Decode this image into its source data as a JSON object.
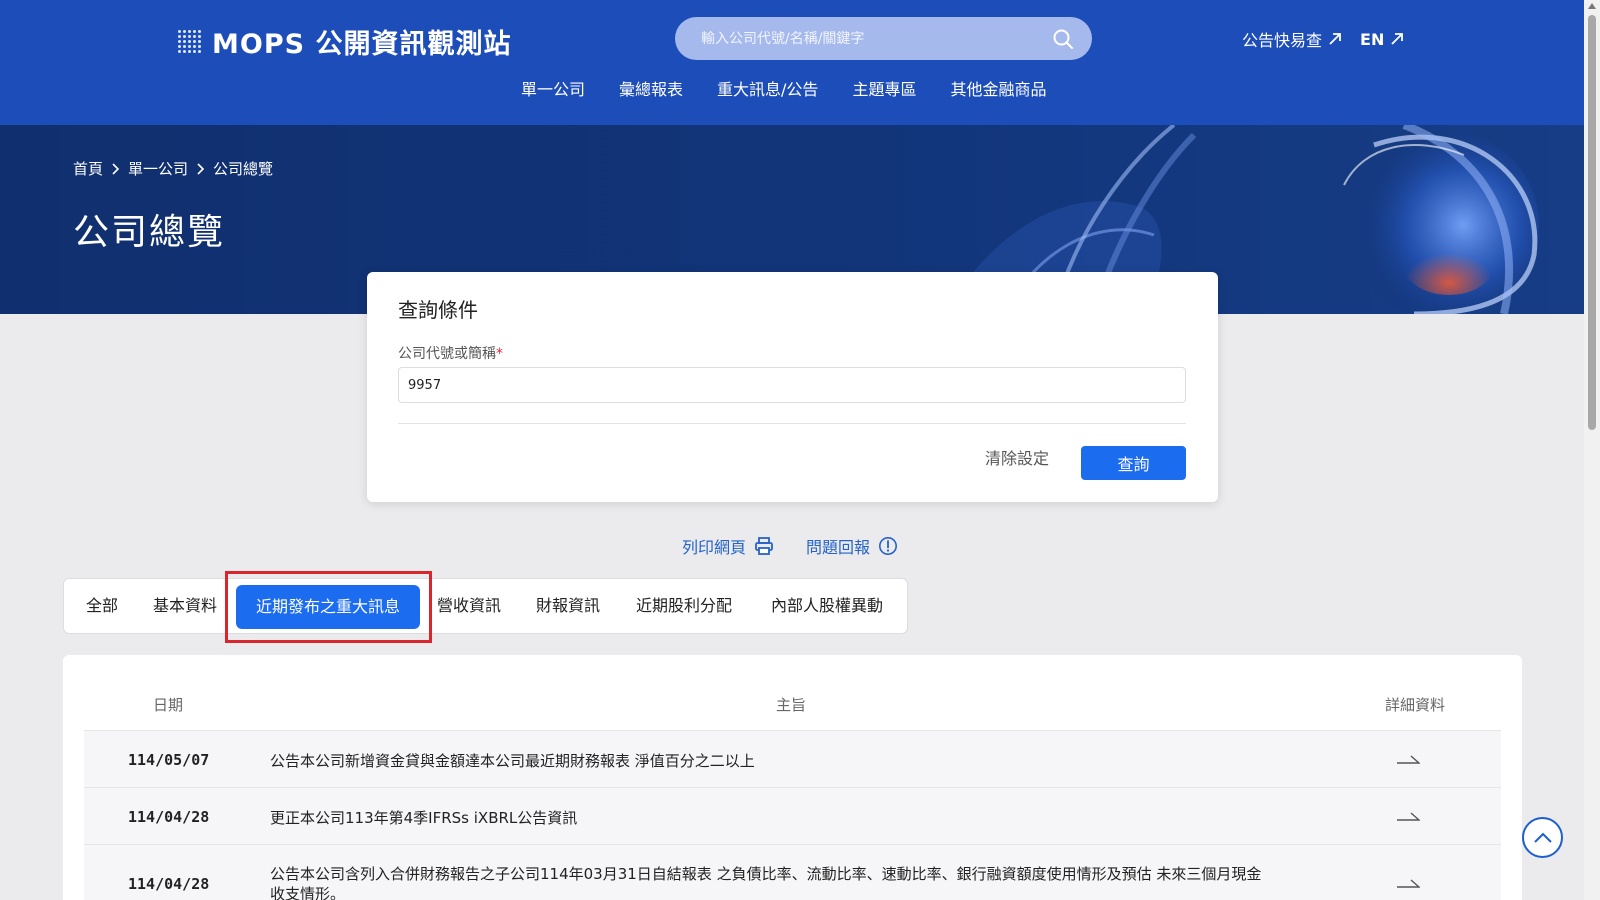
{
  "header": {
    "logo_text": "MOPS 公開資訊觀測站",
    "search_placeholder": "輸入公司代號/名稱/關鍵字",
    "top_links": [
      "公告快易查",
      "EN"
    ],
    "nav": [
      "單一公司",
      "彙總報表",
      "重大訊息/公告",
      "主題專區",
      "其他金融商品"
    ]
  },
  "banner": {
    "breadcrumb": [
      "首頁",
      "單一公司",
      "公司總覽"
    ],
    "title": "公司總覽"
  },
  "query": {
    "title": "查詢條件",
    "field_label": "公司代號或簡稱",
    "required_mark": "*",
    "field_value": "9957",
    "clear_label": "清除設定",
    "submit_label": "查詢"
  },
  "utils": {
    "print_label": "列印網頁",
    "report_label": "問題回報"
  },
  "tabs": {
    "items": [
      "全部",
      "基本資料",
      "近期發布之重大訊息",
      "營收資訊",
      "財報資訊",
      "近期股利分配",
      "內部人股權異動"
    ],
    "active_index": 2
  },
  "table": {
    "headers": {
      "date": "日期",
      "subject": "主旨",
      "detail": "詳細資料"
    },
    "rows": [
      {
        "date": "114/05/07",
        "subject": "公告本公司新增資金貸與金額達本公司最近期財務報表 淨值百分之二以上"
      },
      {
        "date": "114/04/28",
        "subject": "更正本公司113年第4季IFRSs iXBRL公告資訊"
      },
      {
        "date": "114/04/28",
        "subject": "公告本公司含列入合併財務報告之子公司114年03月31日自結報表 之負債比率、流動比率、速動比率、銀行融資額度使用情形及預估 未來三個月現金收支情形。"
      }
    ]
  },
  "colors": {
    "header_bg": "#1d4db8",
    "banner_bg": "#12357a",
    "accent": "#1c6cf0",
    "highlight": "#d9252c"
  }
}
